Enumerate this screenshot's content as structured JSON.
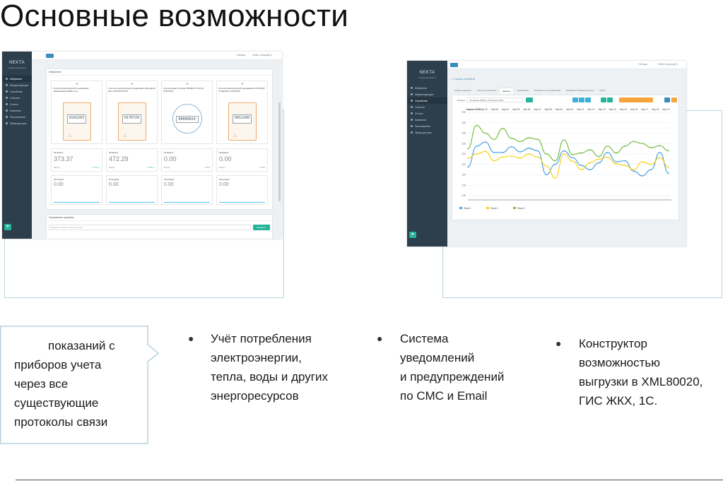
{
  "title": "Основные возможности",
  "left_screen": {
    "logo": "NEKTA",
    "user": "main@nekta.tech ▾",
    "menu": [
      {
        "label": "Избранное",
        "active": true
      },
      {
        "label": "Инфраструктура",
        "active": false
      },
      {
        "label": "Устройства",
        "active": false
      },
      {
        "label": "События",
        "active": false
      },
      {
        "label": "Отчеты",
        "active": false
      },
      {
        "label": "Компании",
        "active": false
      },
      {
        "label": "Пользователи",
        "active": false
      },
      {
        "label": "Права доступа",
        "active": false
      }
    ],
    "topbar_help": "Помощь",
    "topbar_lang": "Switch Language ▾",
    "panel_title": "Избранное",
    "devices": [
      {
        "title": "Счетчик электрической трехфазный «Энергомера СЕ30х.ххх»",
        "reading": "0242263",
        "type": "orange"
      },
      {
        "title": "Счетчик электрической трехфазный «Меркурий 23х» (ХХХ/ХХХХХХ)",
        "reading": "0176729",
        "type": "orange"
      },
      {
        "title": "Счетчик воды Пульсар ПМ-ВКО 16-15 4Х (ХХХХХХ)",
        "reading": "00000024",
        "type": "round"
      },
      {
        "title": "Счетчик электрической однофазный «СОЭ-5И/Ч-1(ДХ)ХХ» (ХХХХХХ)",
        "reading": "0012180",
        "type": "orange"
      }
    ],
    "stats": [
      {
        "label": "За апрель",
        "value": "373.37",
        "sub": "Расход",
        "pct": "7.17% ▲"
      },
      {
        "label": "За апрель",
        "value": "472.29",
        "sub": "Расход",
        "pct": "2.72% ▲"
      },
      {
        "label": "За апрель",
        "value": "0.00",
        "sub": "Расход",
        "pct": "0.00%"
      },
      {
        "label": "За апрель",
        "value": "0.00",
        "sub": "Расход",
        "pct": "0.00%"
      }
    ],
    "stats2": [
      {
        "label": "За сегодня",
        "value": "0.00"
      },
      {
        "label": "За сегодня",
        "value": "0.00"
      },
      {
        "label": "За сегодня",
        "value": "0.00"
      },
      {
        "label": "За сегодня",
        "value": "0.00"
      }
    ],
    "groups_title": "Управление группами",
    "groups_placeholder": "Введите название новой группы",
    "groups_button": "Добавить"
  },
  "right_screen": {
    "logo": "NEKTA",
    "user": "main@nekta.tech ▾",
    "menu": [
      {
        "label": "Избранное",
        "active": false
      },
      {
        "label": "Инфраструктура",
        "active": false
      },
      {
        "label": "Устройства",
        "active": true
      },
      {
        "label": "События",
        "active": false
      },
      {
        "label": "Отчеты",
        "active": false
      },
      {
        "label": "Компании",
        "active": false
      },
      {
        "label": "Пользователи",
        "active": false
      },
      {
        "label": "Права доступа",
        "active": false
      }
    ],
    "topbar_help": "Помощь",
    "topbar_lang": "Switch Language ▾",
    "back_link": "К списку устройств",
    "tabs": [
      "Общие сведения",
      "Поля об устройстве",
      "Данные",
      "Управление",
      "Привязка к пользователям",
      "Привязка к Инфраструктуре",
      "Карта"
    ],
    "active_tab": "Данные",
    "period_label": "Период",
    "period_value": "01 апреля 2018 по 19 апреля 2018",
    "chart_data": {
      "type": "line",
      "categories": [
        "Апрель 2018",
        "Апр 02",
        "Апр 03",
        "Апр 04",
        "Апр 05",
        "Апр 06",
        "Апр 07",
        "Апр 08",
        "Апр 09",
        "Апр 10",
        "Апр 11",
        "Апр 12",
        "Апр 13",
        "Апр 14",
        "Апр 15",
        "Апр 16",
        "Апр 17",
        "Апр 18",
        "Апр 19"
      ],
      "ylim": [
        216,
        232
      ],
      "yticks": [
        216,
        218,
        220,
        222,
        224,
        226,
        228,
        230,
        232
      ],
      "colors": [
        "#4aa3df",
        "#f5d21e",
        "#7cbd44"
      ],
      "series": [
        {
          "name": "Фаза 1",
          "values": [
            221.5,
            225.5,
            226.3,
            224.3,
            224.3,
            225.4,
            224.4,
            225.1,
            224.6,
            220.0,
            222.0,
            224.6,
            223.3,
            221.8,
            221.0,
            222.3,
            224.3,
            222.5,
            222.7,
            220.7,
            219.8,
            221.0,
            224.3,
            220.3
          ]
        },
        {
          "name": "Фаза 2",
          "values": [
            223.2,
            224.0,
            224.5,
            222.7,
            223.4,
            223.6,
            223.2,
            224.0,
            223.4,
            221.7,
            219.4,
            224.0,
            222.6,
            221.0,
            222.3,
            223.0,
            223.4,
            222.1,
            221.8,
            221.0,
            222.5,
            222.0,
            223.3,
            221.5
          ]
        },
        {
          "name": "Фаза 3",
          "values": [
            225.0,
            229.5,
            228.0,
            226.8,
            228.9,
            227.0,
            226.4,
            227.1,
            226.8,
            224.0,
            222.7,
            226.7,
            223.9,
            224.2,
            224.8,
            223.5,
            225.5,
            224.2,
            225.5,
            226.4,
            226.0,
            225.2,
            225.6,
            224.6
          ]
        }
      ]
    }
  },
  "callout": {
    "lines": [
      "показаний  с",
      "приборов учета",
      "через все",
      "существующие",
      "протоколы связи"
    ]
  },
  "bullets": [
    {
      "lines": [
        "Учёт потребления",
        "электроэнергии,",
        "тепла, воды и других",
        "энергоресурсов"
      ]
    },
    {
      "lines": [
        "Система",
        "уведомлений",
        "и предупреждений",
        "по СМС и Email"
      ]
    },
    {
      "lines": [
        "Конструктор",
        "возможностью",
        "выгрузки в XML80020,",
        "ГИС ЖКХ, 1С."
      ]
    }
  ],
  "bullet_symbol": "●"
}
